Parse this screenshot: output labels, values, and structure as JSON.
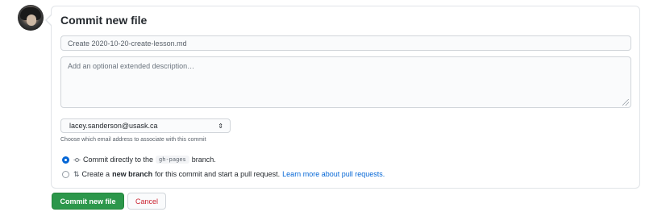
{
  "commit_form": {
    "title": "Commit new file",
    "summary_value": "Create 2020-10-20-create-lesson.md",
    "description_placeholder": "Add an optional extended description…",
    "email_selected": "lacey.sanderson@usask.ca",
    "email_hint": "Choose which email address to associate with this commit",
    "options": {
      "direct": {
        "text_before": "Commit directly to the",
        "branch": "gh-pages",
        "text_after": "branch.",
        "checked": true
      },
      "new_branch": {
        "text_before": "Create a",
        "bold": "new branch",
        "text_after": "for this commit and start a pull request.",
        "link": "Learn more about pull requests.",
        "checked": false
      }
    },
    "buttons": {
      "commit": "Commit new file",
      "cancel": "Cancel"
    }
  },
  "colors": {
    "commit_button": "#2c974b",
    "cancel_text": "#cb2431",
    "link": "#0366d6",
    "radio_checked": "#0366d6"
  },
  "icons": {
    "avatar": "user-avatar",
    "direct_commit": "git-commit-icon",
    "new_branch": "git-pull-request-icon",
    "select_caret": "select-caret-icon"
  }
}
